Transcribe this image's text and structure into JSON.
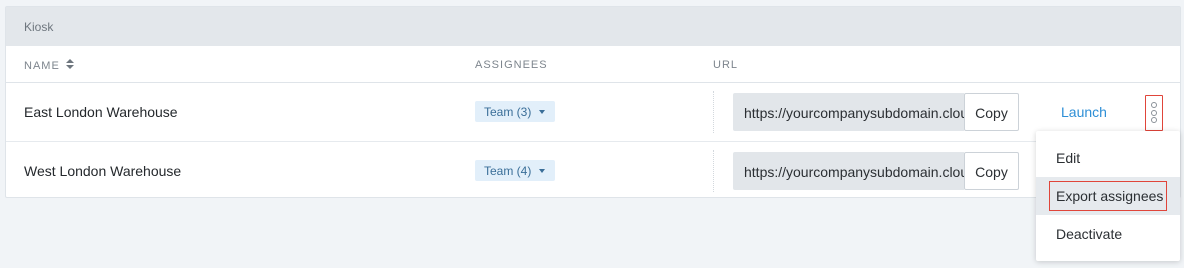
{
  "section": {
    "title": "Kiosk"
  },
  "columns": {
    "name": "NAME",
    "assignees": "ASSIGNEES",
    "url": "URL"
  },
  "rows": [
    {
      "name": "East London Warehouse",
      "team": "Team (3)",
      "url": "https://yourcompanysubdomain.cloud",
      "copy": "Copy",
      "launch": "Launch"
    },
    {
      "name": "West London Warehouse",
      "team": "Team (4)",
      "url": "https://yourcompanysubdomain.cloud",
      "copy": "Copy"
    }
  ],
  "menu": {
    "items": [
      "Edit",
      "Export assignees",
      "Deactivate"
    ]
  },
  "icons": {
    "sort": "sort-icon",
    "caret": "chevron-down-icon",
    "more": "more-vertical-icon"
  },
  "colors": {
    "accent": "#2e8fd6",
    "highlight": "#e0453a",
    "badge_bg": "#e2effa"
  }
}
